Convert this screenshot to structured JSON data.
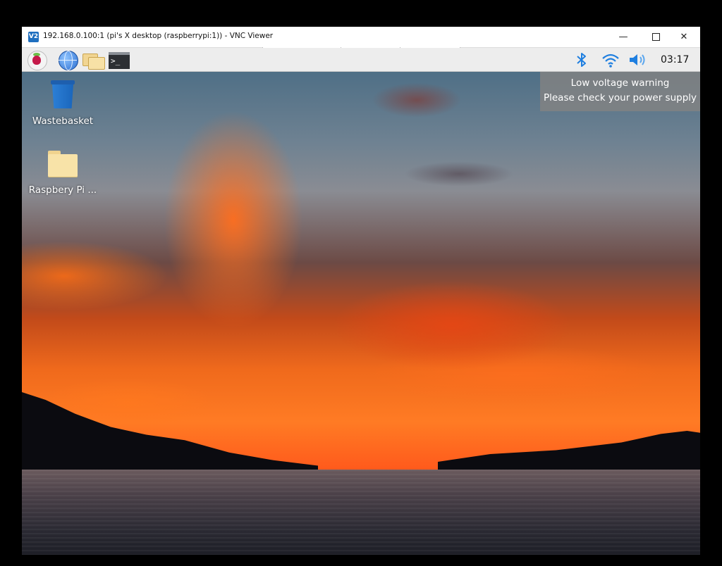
{
  "window": {
    "title": "192.168.0.100:1 (pi's X desktop (raspberrypi:1)) - VNC Viewer",
    "app_icon": "V2",
    "controls": {
      "minimize": "—",
      "close": "✕"
    }
  },
  "taskbar": {
    "launchers": [
      {
        "name": "raspberry-pi-menu"
      },
      {
        "name": "web-browser"
      },
      {
        "name": "file-manager"
      },
      {
        "name": "terminal",
        "glyph": ">_"
      }
    ],
    "tray": {
      "bluetooth_icon": "bluetooth-icon",
      "wifi_icon": "wifi-icon",
      "volume_icon": "volume-icon",
      "clock": "03:17"
    }
  },
  "desktop": {
    "icons": [
      {
        "label": "Wastebasket",
        "icon": "trash-icon"
      },
      {
        "label": "Raspbery Pi ...",
        "icon": "folder-icon"
      }
    ]
  },
  "notification": {
    "line1": "Low voltage warning",
    "line2": "Please check your power supply"
  },
  "colors": {
    "taskbar_bg": "#ededed",
    "tray_icon": "#1f7fe0",
    "notify_bg": "#828282"
  }
}
